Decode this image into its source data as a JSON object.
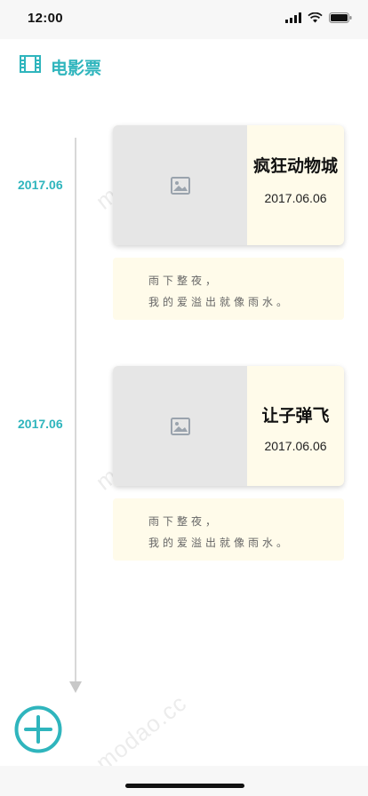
{
  "status_bar": {
    "time": "12:00"
  },
  "header": {
    "title": "电影票",
    "icon": "film-icon"
  },
  "colors": {
    "accent": "#2fb5bd",
    "card_bg": "#fffbea",
    "poster_bg": "#e6e6e6",
    "timeline": "#d8d8d8"
  },
  "entries": [
    {
      "date_label": "2017.06",
      "title": "疯狂动物城",
      "date": "2017.06.06",
      "quote_line1": "雨下整夜，",
      "quote_line2": "我的爱溢出就像雨水。"
    },
    {
      "date_label": "2017.06",
      "title": "让子弹飞",
      "date": "2017.06.06",
      "quote_line1": "雨下整夜，",
      "quote_line2": "我的爱溢出就像雨水。"
    }
  ],
  "watermark": "modao.cc",
  "add_button": {
    "icon": "plus-icon"
  }
}
